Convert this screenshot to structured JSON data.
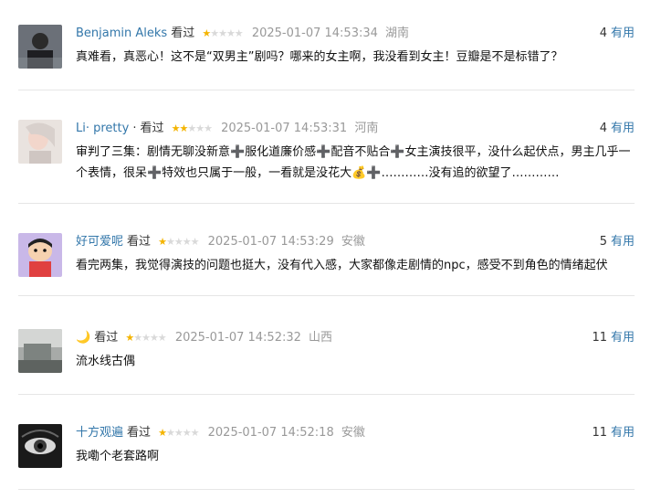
{
  "comments": [
    {
      "user": "Benjamin Aleks",
      "watched": "看过",
      "rating": 1,
      "time": "2025-01-07 14:53:34",
      "location": "湖南",
      "useful_count": "4",
      "useful_label": "有用",
      "text": "真难看，真恶心！这不是“双男主”剧吗？哪来的女主啊，我没看到女主！豆瓣是不是标错了？"
    },
    {
      "user": "Li· pretty",
      "sep": "·",
      "watched": "看过",
      "rating": 2,
      "time": "2025-01-07 14:53:31",
      "location": "河南",
      "useful_count": "4",
      "useful_label": "有用",
      "text": "审判了三集：剧情无聊没新意➕服化道廉价感➕配音不贴合➕女主演技很平，没什么起伏点，男主几乎一个表情，很呆➕特效也只属于一般，一看就是没花大💰➕…………没有追的欲望了…………"
    },
    {
      "user": "好可爱呢",
      "watched": "看过",
      "rating": 1,
      "time": "2025-01-07 14:53:29",
      "location": "安徽",
      "useful_count": "5",
      "useful_label": "有用",
      "text": "看完两集，我觉得演技的问题也挺大，没有代入感，大家都像走剧情的npc，感受不到角色的情绪起伏"
    },
    {
      "user": "🌙",
      "watched": "看过",
      "rating": 1,
      "time": "2025-01-07 14:52:32",
      "location": "山西",
      "useful_count": "11",
      "useful_label": "有用",
      "text": "流水线古偶"
    },
    {
      "user": "十方观遍",
      "watched": "看过",
      "rating": 1,
      "time": "2025-01-07 14:52:18",
      "location": "安徽",
      "useful_count": "11",
      "useful_label": "有用",
      "text": "我嘞个老套路啊"
    }
  ],
  "colors": {
    "username": "#3377aa",
    "star_on": "#f4b400",
    "star_off": "#d9d9d9",
    "meta_gray": "#999999"
  }
}
